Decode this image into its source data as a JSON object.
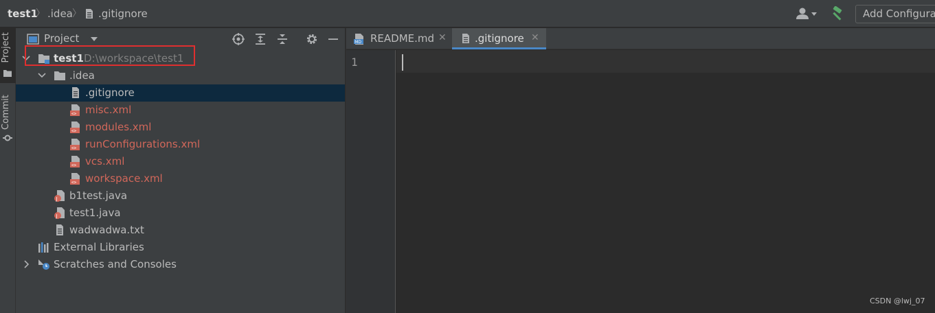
{
  "breadcrumb": {
    "project": "test1",
    "folder": ".idea",
    "file": ".gitignore"
  },
  "toolbar": {
    "add_configuration": "Add Configuration..."
  },
  "tool_stripe": {
    "project_label": "Project",
    "commit_label": "Commit"
  },
  "project_panel": {
    "title": "Project",
    "header_icons": [
      "target-icon",
      "expand-all-icon",
      "collapse-all-icon",
      "gear-icon",
      "minimize-icon"
    ],
    "tree": [
      {
        "label": "test1",
        "path": "D:\\workspace\\test1",
        "depth": 0,
        "expanded": true,
        "type": "module-folder",
        "bold": true
      },
      {
        "label": ".idea",
        "depth": 1,
        "expanded": true,
        "type": "folder"
      },
      {
        "label": ".gitignore",
        "depth": 2,
        "type": "text-file",
        "selected": true
      },
      {
        "label": "misc.xml",
        "depth": 2,
        "type": "xml-file",
        "status": "unversioned"
      },
      {
        "label": "modules.xml",
        "depth": 2,
        "type": "xml-file",
        "status": "unversioned"
      },
      {
        "label": "runConfigurations.xml",
        "depth": 2,
        "type": "xml-file",
        "status": "unversioned"
      },
      {
        "label": "vcs.xml",
        "depth": 2,
        "type": "xml-file",
        "status": "unversioned"
      },
      {
        "label": "workspace.xml",
        "depth": 2,
        "type": "xml-file",
        "status": "unversioned"
      },
      {
        "label": "b1test.java",
        "depth": 1,
        "type": "java-file"
      },
      {
        "label": "test1.java",
        "depth": 1,
        "type": "java-file"
      },
      {
        "label": "wadwadwa.txt",
        "depth": 1,
        "type": "text-file"
      },
      {
        "label": "External Libraries",
        "depth": 0,
        "type": "libraries"
      },
      {
        "label": "Scratches and Consoles",
        "depth": 0,
        "type": "scratches",
        "collapsed": true
      }
    ]
  },
  "editor": {
    "tabs": [
      {
        "label": "README.md",
        "icon": "markdown-file-icon",
        "active": false
      },
      {
        "label": ".gitignore",
        "icon": "text-file-icon",
        "active": true
      }
    ],
    "line_numbers": [
      "1"
    ]
  },
  "watermark": "CSDN @lwj_07",
  "colors": {
    "unversioned": "#d1675a",
    "selection": "#0d293e",
    "accent": "#4a88c7",
    "highlight_box": "#e02f2f"
  }
}
